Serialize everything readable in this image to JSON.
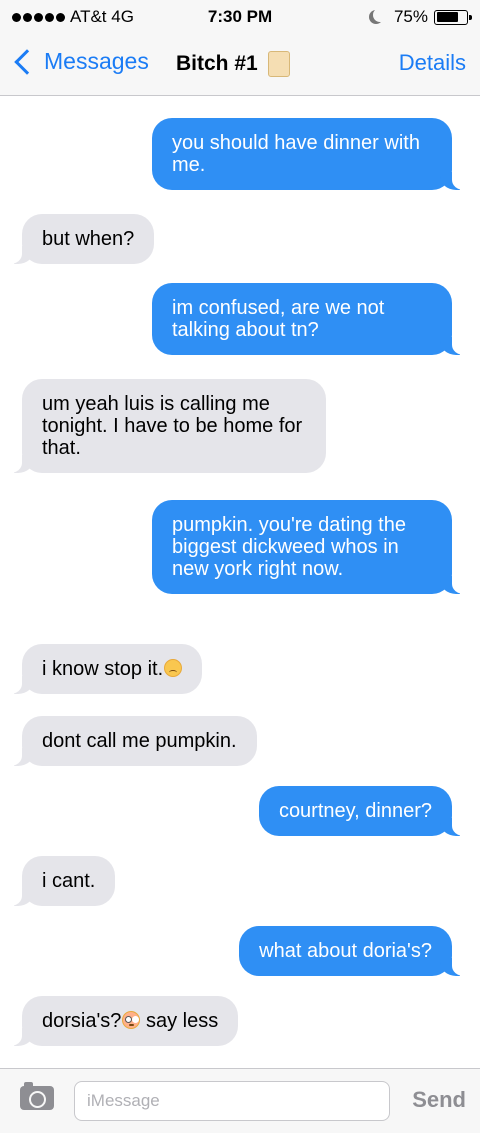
{
  "status_bar": {
    "carrier": "AT&t",
    "network": "4G",
    "time": "7:30 PM",
    "battery": "75%",
    "battery_level": 0.75
  },
  "nav": {
    "back_label": "Messages",
    "contact_name": "Bitch #1",
    "details_label": "Details"
  },
  "messages": [
    {
      "direction": "outgoing",
      "text": "you should have dinner with me."
    },
    {
      "direction": "incoming",
      "text": "but when?"
    },
    {
      "direction": "outgoing",
      "text": "im confused, are we not talking about tn?"
    },
    {
      "direction": "incoming",
      "text": "um yeah luis is calling me tonight. I have to be home for that."
    },
    {
      "direction": "outgoing",
      "text": "pumpkin. you're dating the biggest dickweed whos in new york right now."
    },
    {
      "direction": "incoming",
      "text": "i know stop it.",
      "emoji": "disappointed-face"
    },
    {
      "direction": "incoming",
      "text": "dont call me pumpkin."
    },
    {
      "direction": "outgoing",
      "text": "courtney, dinner?"
    },
    {
      "direction": "incoming",
      "text": "i cant."
    },
    {
      "direction": "outgoing",
      "text": "what about doria's?"
    },
    {
      "direction": "incoming",
      "text": "dorsia's?",
      "text_after": " say less",
      "emoji": "flushed-face"
    }
  ],
  "input": {
    "placeholder": "iMessage",
    "value": "",
    "send_label": "Send"
  },
  "colors": {
    "accent": "#1b7cf5",
    "outgoing_bubble": "#2f8ff4",
    "incoming_bubble": "#e5e5ea"
  }
}
